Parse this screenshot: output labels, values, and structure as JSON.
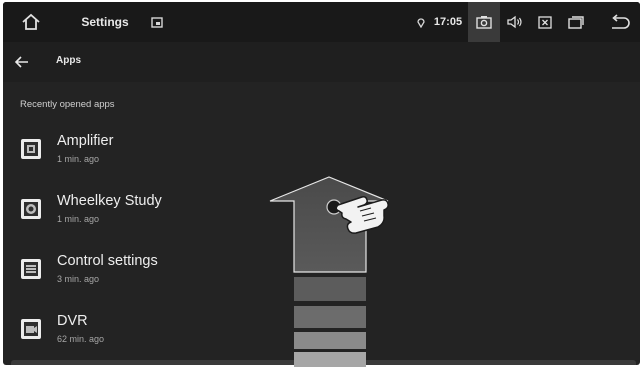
{
  "statusbar": {
    "icons": {
      "home": "home-icon",
      "window": "window-icon",
      "location": "location-icon",
      "camera": "camera-icon",
      "volume": "volume-icon",
      "close": "close-box-icon",
      "recents": "recents-icon",
      "back": "back-arrow-icon"
    },
    "title": "Settings",
    "time": "17:05"
  },
  "toolbar": {
    "title": "Apps"
  },
  "recent": {
    "label": "Recently opened apps",
    "apps": [
      {
        "name": "Amplifier",
        "time": "1 min. ago"
      },
      {
        "name": "Wheelkey Study",
        "time": "1 min. ago"
      },
      {
        "name": "Control settings",
        "time": "3 min. ago"
      },
      {
        "name": "DVR",
        "time": "62 min. ago"
      }
    ]
  },
  "colors": {
    "background": "#232323",
    "statusbar": "#191919",
    "text": "#eeeeee",
    "subtext": "#a6a6a6"
  }
}
